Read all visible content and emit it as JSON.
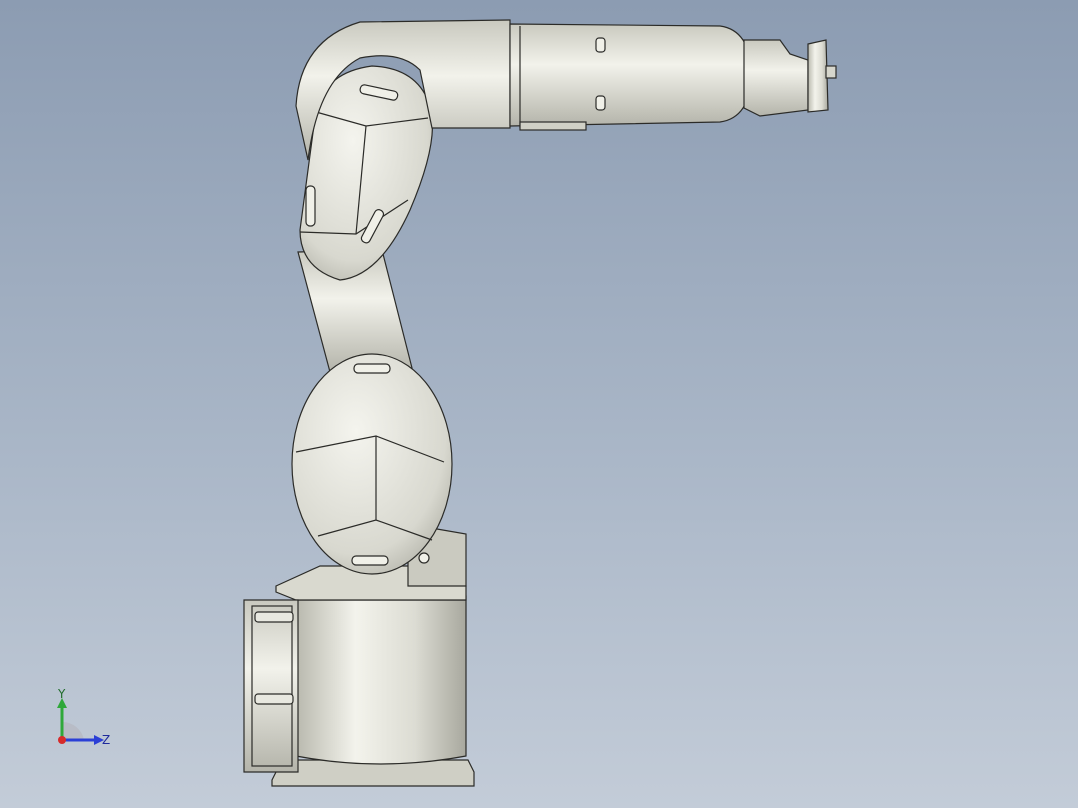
{
  "viewport": {
    "background_top": "#8c9cb2",
    "background_bottom": "#c3ccd8",
    "model_fill": "#e4e4dc",
    "model_shade": "#bfc0b6",
    "edge_color": "#2b2b28"
  },
  "triad": {
    "y_label": "Y",
    "z_label": "Z",
    "y_axis_color": "#2fa83a",
    "z_axis_color": "#2b3fd6",
    "x_axis_color": "#d62b2b"
  }
}
